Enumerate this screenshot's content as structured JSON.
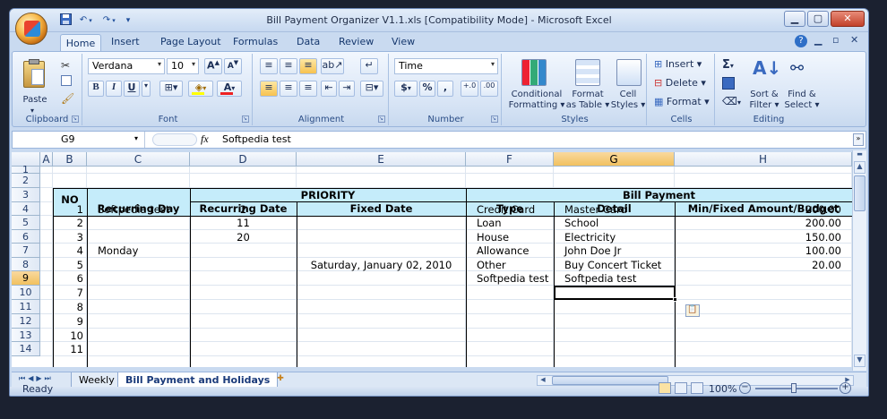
{
  "window": {
    "title": "Bill Payment Organizer V1.1.xls  [Compatibility Mode] - Microsoft Excel"
  },
  "tabs": [
    "Home",
    "Insert",
    "Page Layout",
    "Formulas",
    "Data",
    "Review",
    "View"
  ],
  "ribbon": {
    "clipboard": {
      "label": "Clipboard",
      "paste": "Paste"
    },
    "font": {
      "label": "Font",
      "family": "Verdana",
      "size": "10",
      "bold": "B",
      "italic": "I",
      "underline": "U"
    },
    "alignment": {
      "label": "Alignment"
    },
    "number": {
      "label": "Number",
      "format": "Time",
      "currency": "$",
      "percent": "%",
      "comma": ","
    },
    "styles": {
      "label": "Styles",
      "cond1": "Conditional",
      "cond2": "Formatting",
      "fmt1": "Format",
      "fmt2": "as Table",
      "cell1": "Cell",
      "cell2": "Styles"
    },
    "cells": {
      "label": "Cells",
      "insert": "Insert",
      "delete": "Delete",
      "format": "Format"
    },
    "editing": {
      "label": "Editing",
      "sort1": "Sort &",
      "sort2": "Filter",
      "find1": "Find &",
      "find2": "Select",
      "sigma": "Σ"
    }
  },
  "formula_bar": {
    "name_box": "G9",
    "fx": "fx",
    "content": "Softpedia test"
  },
  "columns": [
    "A",
    "B",
    "C",
    "D",
    "E",
    "F",
    "G",
    "H"
  ],
  "rows": [
    "1",
    "2",
    "3",
    "4",
    "5",
    "6",
    "7",
    "8",
    "9",
    "10",
    "11",
    "12",
    "13",
    "14"
  ],
  "sheet": {
    "no_label": "NO",
    "priority": "PRIORITY",
    "bill_payment": "Bill Payment",
    "h_recurring_day": "Recurring Day",
    "h_recurring_date": "Recurring Date",
    "h_fixed_date": "Fixed Date",
    "h_type": "Type",
    "h_detail": "Detail",
    "h_amount": "Min/Fixed Amount/Budget",
    "data": [
      {
        "no": "1",
        "day": "Softpedia test",
        "date": "2",
        "fixed": "",
        "type": "Credit Card",
        "detail": "Master Card",
        "amount": "200.00"
      },
      {
        "no": "2",
        "day": "",
        "date": "11",
        "fixed": "",
        "type": "Loan",
        "detail": "School",
        "amount": "200.00"
      },
      {
        "no": "3",
        "day": "",
        "date": "20",
        "fixed": "",
        "type": "House",
        "detail": "Electricity",
        "amount": "150.00"
      },
      {
        "no": "4",
        "day": "Monday",
        "date": "",
        "fixed": "",
        "type": "Allowance",
        "detail": "John Doe Jr",
        "amount": "100.00"
      },
      {
        "no": "5",
        "day": "",
        "date": "",
        "fixed": "Saturday, January 02, 2010",
        "type": "Other",
        "detail": "Buy Concert Ticket",
        "amount": "20.00"
      },
      {
        "no": "6",
        "day": "",
        "date": "",
        "fixed": "",
        "type": "Softpedia test",
        "detail": "Softpedia test",
        "amount": ""
      },
      {
        "no": "7",
        "day": "",
        "date": "",
        "fixed": "",
        "type": "",
        "detail": "",
        "amount": ""
      },
      {
        "no": "8",
        "day": "",
        "date": "",
        "fixed": "",
        "type": "",
        "detail": "",
        "amount": ""
      },
      {
        "no": "9",
        "day": "",
        "date": "",
        "fixed": "",
        "type": "",
        "detail": "",
        "amount": ""
      },
      {
        "no": "10",
        "day": "",
        "date": "",
        "fixed": "",
        "type": "",
        "detail": "",
        "amount": ""
      },
      {
        "no": "11",
        "day": "",
        "date": "",
        "fixed": "",
        "type": "",
        "detail": "",
        "amount": ""
      }
    ]
  },
  "sheet_tabs": [
    "Weekly",
    "Bill Payment and Holidays"
  ],
  "status": {
    "ready": "Ready",
    "zoom": "100%"
  }
}
